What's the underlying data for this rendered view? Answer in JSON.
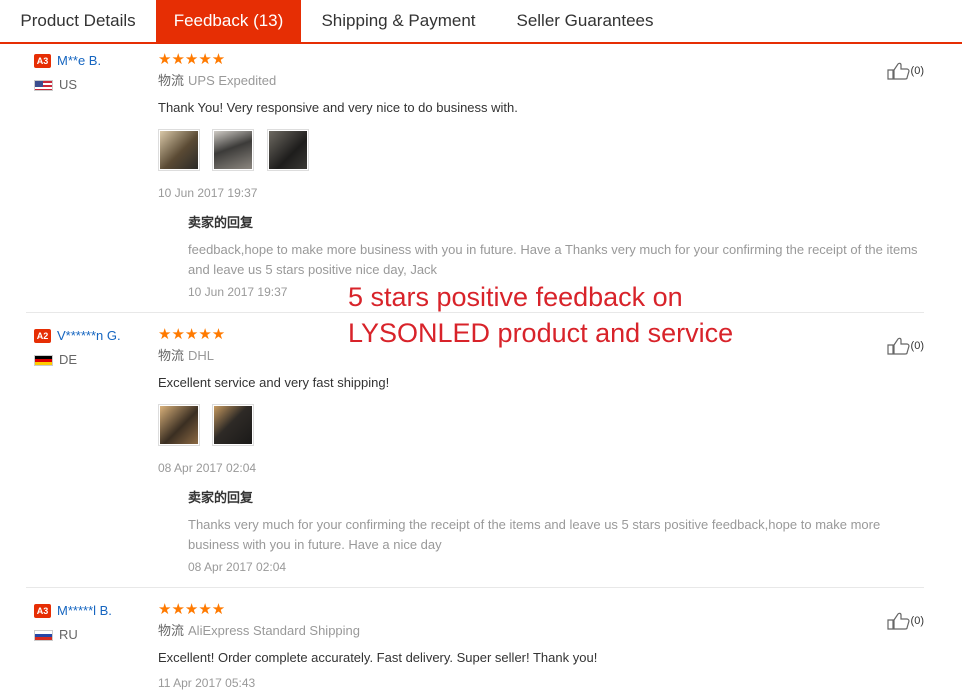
{
  "tabs": [
    {
      "label": "Product Details"
    },
    {
      "label": "Feedback (13)"
    },
    {
      "label": "Shipping & Payment"
    },
    {
      "label": "Seller Guarantees"
    }
  ],
  "feedback": [
    {
      "level": "A3",
      "user": "M**e B.",
      "country": "US",
      "stars": "★★★★★",
      "shipping_label": "物流",
      "shipping": "UPS Expedited",
      "text": "Thank You! Very responsive and very nice to do business with.",
      "date": "10 Jun 2017 19:37",
      "reply_title": "卖家的回复",
      "reply_text": "feedback,hope to make more business with you in future. Have a Thanks very much for your confirming the receipt of the items and leave us 5 stars positive nice day, Jack",
      "reply_date": "10 Jun 2017 19:37",
      "likes": "(0)"
    },
    {
      "level": "A2",
      "user": "V******n G.",
      "country": "DE",
      "stars": "★★★★★",
      "shipping_label": "物流",
      "shipping": "DHL",
      "text": "Excellent service and very fast shipping!",
      "date": "08 Apr 2017 02:04",
      "reply_title": "卖家的回复",
      "reply_text": "Thanks very much for your confirming the receipt of the items and leave us 5 stars positive feedback,hope to make more business with you in future. Have a nice day",
      "reply_date": "08 Apr 2017 02:04",
      "likes": "(0)"
    },
    {
      "level": "A3",
      "user": "M*****l B.",
      "country": "RU",
      "stars": "★★★★★",
      "shipping_label": "物流",
      "shipping": "AliExpress Standard Shipping",
      "text": "Excellent! Order complete accurately. Fast delivery. Super seller! Thank you!",
      "date": "11 Apr 2017 05:43",
      "likes": "(0)"
    }
  ],
  "overlay": {
    "line1": "5 stars positive feedback on",
    "line2": "LYSONLED product and service"
  },
  "colors": {
    "accent": "#e62e04",
    "star": "#ff7a00",
    "username": "#1565c0",
    "overlay_text": "#d8232a"
  }
}
